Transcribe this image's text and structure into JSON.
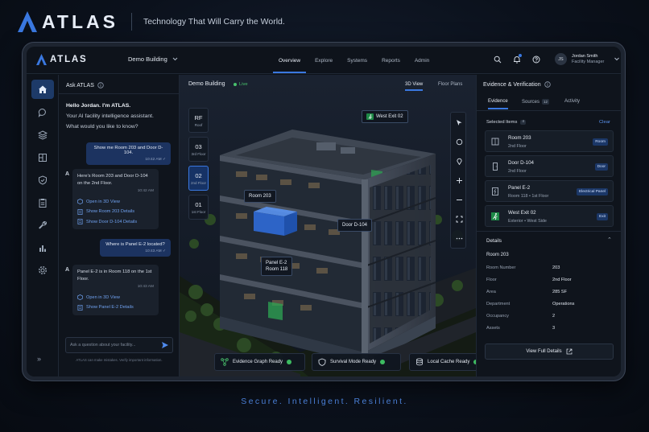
{
  "brand": {
    "name": "ATLAS",
    "tagline": "Technology That Will Carry the World."
  },
  "footer": {
    "tagline": "Secure.  Intelligent.  Resilient."
  },
  "colors": {
    "accent": "#3a78e0",
    "live": "#49c26d",
    "exit": "#1e8a47"
  },
  "topnav": {
    "logo": "ATLAS",
    "building": "Demo Building",
    "links": [
      "Overview",
      "Explore",
      "Systems",
      "Reports",
      "Admin"
    ],
    "active_link": "Overview",
    "icons": [
      "search-icon",
      "bell-icon",
      "help-icon"
    ],
    "user": {
      "initials": "JS",
      "name": "Jordan Smith",
      "role": "Facility Manager"
    }
  },
  "rail": {
    "items": [
      "home-icon",
      "chat-icon",
      "layers-icon",
      "floorplan-icon",
      "shield-icon",
      "clipboard-icon",
      "wrench-icon",
      "chart-icon",
      "settings-icon"
    ],
    "collapse": "»"
  },
  "ask": {
    "title": "Ask ATLAS",
    "greeting": "Hello Jordan. I'm ATLAS.",
    "intro1": "Your AI facility intelligence assistant.",
    "intro2": "What would you like to know?",
    "msg1": {
      "text": "Show me Room 203 and Door D-104.",
      "time": "10:42 AM"
    },
    "reply1": {
      "avatar": "A",
      "text": "Here's Room 203 and Door D-104 on the 2nd Floor.",
      "time": "10:42 AM",
      "links": [
        "Open in 3D View",
        "Show Room 203 Details",
        "Show Door D-104 Details"
      ]
    },
    "msg2": {
      "text": "Where is Panel E-2 located?",
      "time": "10:43 AM"
    },
    "reply2": {
      "avatar": "A",
      "text": "Panel E-2 is in Room 118 on the 1st Floor.",
      "time": "10:43 AM",
      "links": [
        "Open in 3D View",
        "Show Panel E-2 Details"
      ]
    },
    "input_placeholder": "Ask a question about your facility...",
    "disclaimer": "ATLAS can make mistakes. Verify important information."
  },
  "center": {
    "title": "Demo Building",
    "live": "Live",
    "views": [
      "3D View",
      "Floor Plans"
    ],
    "active_view": "3D View",
    "floors": [
      {
        "num": "RF",
        "label": "Roof"
      },
      {
        "num": "03",
        "label": "3rd Floor"
      },
      {
        "num": "02",
        "label": "2nd Floor"
      },
      {
        "num": "01",
        "label": "1st Floor"
      }
    ],
    "active_floor": "02",
    "tools": [
      "cursor-icon",
      "circle-icon",
      "pin-icon",
      "plus-icon",
      "minus-icon",
      "expand-icon",
      "more-icon"
    ],
    "callouts": {
      "west_exit": "West Exit 02",
      "room": "Room 203",
      "door": "Door D-104",
      "panel_line1": "Panel E-2",
      "panel_line2": "Room 118"
    },
    "status": [
      "Evidence Graph Ready",
      "Survival Mode Ready",
      "Local Cache Ready"
    ]
  },
  "right": {
    "title": "Evidence & Verification",
    "tabs": [
      {
        "label": "Evidence",
        "count": ""
      },
      {
        "label": "Sources",
        "count": "12"
      },
      {
        "label": "Activity",
        "count": ""
      }
    ],
    "selected_label": "Selected Items",
    "selected_count": "4",
    "clear": "Clear",
    "items": [
      {
        "title": "Room 203",
        "sub": "2nd Floor",
        "tag": "Room",
        "icon": "room-icon"
      },
      {
        "title": "Door D-104",
        "sub": "2nd Floor",
        "tag": "Door",
        "icon": "door-icon"
      },
      {
        "title": "Panel E-2",
        "sub": "Room 118  •  1st Floor",
        "tag": "Electrical Panel",
        "icon": "panel-icon"
      },
      {
        "title": "West Exit 02",
        "sub": "Exterior  •  West Side",
        "tag": "Exit",
        "icon": "exit-icon"
      }
    ],
    "details": {
      "heading": "Details",
      "title": "Room 203",
      "rows": [
        {
          "k": "Room Number",
          "v": "203"
        },
        {
          "k": "Floor",
          "v": "2nd Floor"
        },
        {
          "k": "Area",
          "v": "285 SF"
        },
        {
          "k": "Department",
          "v": "Operations"
        },
        {
          "k": "Occupancy",
          "v": "2"
        },
        {
          "k": "Assets",
          "v": "3"
        }
      ],
      "button": "View Full Details"
    }
  }
}
